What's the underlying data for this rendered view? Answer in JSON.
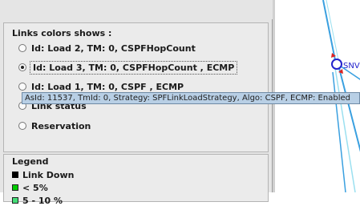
{
  "links_group": {
    "title": "Links colors shows :",
    "options": [
      {
        "label": "Id: Load 2, TM: 0, CSPFHopCount",
        "selected": false
      },
      {
        "label": "Id: Load 3, TM: 0, CSPFHopCount , ECMP",
        "selected": true
      },
      {
        "label": "Id: Load 1, TM: 0, CSPF , ECMP",
        "selected": false
      },
      {
        "label": "Link status",
        "selected": false
      },
      {
        "label": "Reservation",
        "selected": false
      }
    ]
  },
  "tooltip": {
    "text": "AsId: 11537, TmId: 0, Strategy: SPFLinkLoadStrategy, Algo: CSPF, ECMP: Enabled"
  },
  "legend": {
    "title": "Legend",
    "items": [
      {
        "label": "Link Down",
        "color": "#000000"
      },
      {
        "label": "< 5%",
        "color": "#00cc00"
      },
      {
        "label": "5 - 10 %",
        "color": "#44dd77"
      }
    ]
  },
  "graph": {
    "node_label": "SNV",
    "link_color": "#3aa0e0",
    "node_color": "#2222cc",
    "arrow_color": "#dd2222"
  }
}
